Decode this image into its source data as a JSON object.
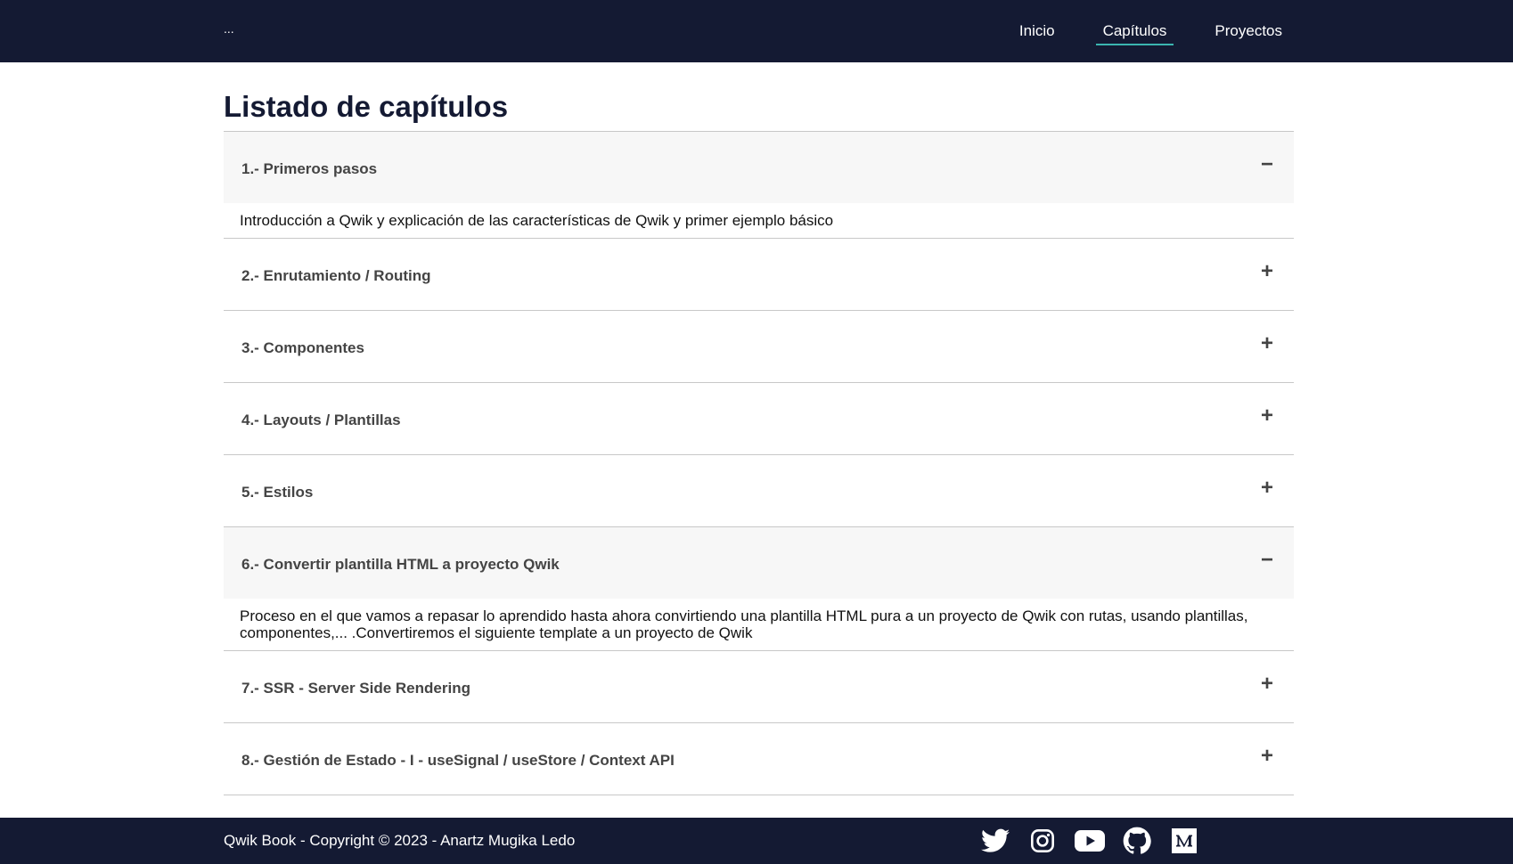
{
  "nav": {
    "brand": "...",
    "links": [
      "Inicio",
      "Capítulos",
      "Proyectos"
    ],
    "active": "Capítulos",
    "accent_color": "#3bb5b0",
    "background": "#141a33"
  },
  "page": {
    "title": "Listado de capítulos"
  },
  "chapters": [
    {
      "title": "1.- Primeros pasos",
      "expanded": true,
      "toggle": "−",
      "description": "Introducción a Qwik y explicación de las características de Qwik y primer ejemplo básico"
    },
    {
      "title": "2.- Enrutamiento / Routing",
      "expanded": false,
      "toggle": "+"
    },
    {
      "title": "3.- Componentes",
      "expanded": false,
      "toggle": "+"
    },
    {
      "title": "4.- Layouts / Plantillas",
      "expanded": false,
      "toggle": "+"
    },
    {
      "title": "5.- Estilos",
      "expanded": false,
      "toggle": "+"
    },
    {
      "title": "6.- Convertir plantilla HTML a proyecto Qwik",
      "expanded": true,
      "toggle": "−",
      "description": "Proceso en el que vamos a repasar lo aprendido hasta ahora convirtiendo una plantilla HTML pura a un proyecto de Qwik con rutas, usando plantillas, componentes,... .Convertiremos el siguiente template a un proyecto de Qwik"
    },
    {
      "title": "7.- SSR - Server Side Rendering",
      "expanded": false,
      "toggle": "+"
    },
    {
      "title": "8.- Gestión de Estado - I - useSignal / useStore / Context API",
      "expanded": false,
      "toggle": "+"
    }
  ],
  "footer": {
    "text": "Qwik Book - Copyright © 2023 - Anartz Mugika Ledo",
    "social_icons": [
      "twitter-icon",
      "instagram-icon",
      "youtube-icon",
      "github-icon",
      "medium-icon"
    ]
  }
}
